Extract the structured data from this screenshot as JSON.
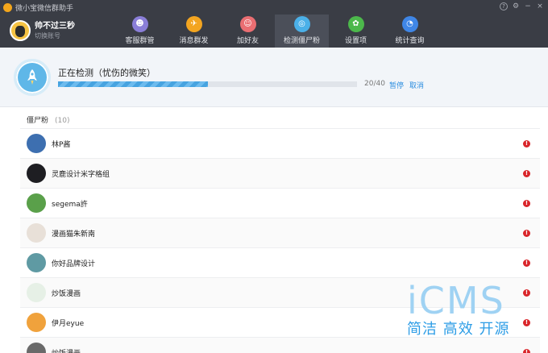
{
  "app": {
    "title": "微小宝微信群助手",
    "window_controls": [
      "?",
      "⚙",
      "−",
      "×"
    ]
  },
  "profile": {
    "name": "帅不过三秒",
    "switch_label": "切换账号"
  },
  "nav": [
    {
      "label": "客服群管",
      "icon": "users-icon",
      "color": "#8a7ed8",
      "glyph": "☻",
      "active": false
    },
    {
      "label": "消息群发",
      "icon": "send-icon",
      "color": "#f3a520",
      "glyph": "✈",
      "active": false
    },
    {
      "label": "加好友",
      "icon": "add-friend-icon",
      "color": "#ea6e72",
      "glyph": "☺",
      "active": false
    },
    {
      "label": "检测僵尸粉",
      "icon": "detect-icon",
      "color": "#4bb0e8",
      "glyph": "◎",
      "active": true
    },
    {
      "label": "设置项",
      "icon": "settings-icon",
      "color": "#4cb84b",
      "glyph": "✿",
      "active": false
    },
    {
      "label": "统计查询",
      "icon": "stats-icon",
      "color": "#3f86e6",
      "glyph": "◔",
      "active": false
    }
  ],
  "detect": {
    "status": "正在检测（忧伤的微笑）",
    "progress_current": 20,
    "progress_total": 40,
    "progress_text": "20/40",
    "pause_label": "暂停",
    "cancel_label": "取消"
  },
  "list": {
    "title": "僵尸粉",
    "count": "(10)",
    "items": [
      {
        "name": "林P酱",
        "avatar_color": "#3d6fb0"
      },
      {
        "name": "灵鹿设计米字格组",
        "avatar_color": "#1e1e22"
      },
      {
        "name": "segema許",
        "avatar_color": "#5aa04a"
      },
      {
        "name": "漫画猫朱新南",
        "avatar_color": "#e8e0d8"
      },
      {
        "name": "你好品牌设计",
        "avatar_color": "#5f9aa3"
      },
      {
        "name": "炒饭漫画",
        "avatar_color": "#e6f0e6"
      },
      {
        "name": "伊月eyue",
        "avatar_color": "#f0a23c"
      },
      {
        "name": "炒饭漫画",
        "avatar_color": "#6a6a6a"
      }
    ],
    "warning_glyph": "!"
  },
  "watermark": {
    "big": "iCMS",
    "small": "简洁 高效 开源"
  }
}
